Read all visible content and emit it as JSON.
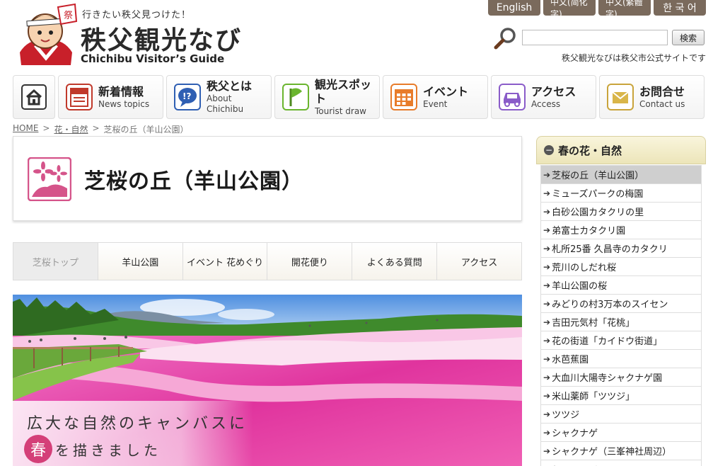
{
  "header": {
    "tagline": "行きたい秩父見つけた！",
    "site_name": "秩父観光なび",
    "site_sub": "Chichibu Visitor’s Guide",
    "mascot_label": "祭",
    "official_note": "秩父観光なびは秩父市公式サイトです"
  },
  "languages": [
    {
      "label": "English"
    },
    {
      "label": "中文(简化字)"
    },
    {
      "label": "中文(繁體字)"
    },
    {
      "label": "한 국 어"
    }
  ],
  "search": {
    "placeholder": "",
    "button_label": "検索",
    "icon": "magnifier-icon"
  },
  "nav": {
    "home_icon": "house-icon",
    "items": [
      {
        "ja": "新着情報",
        "en": "News topics",
        "icon": "news-icon",
        "color": "#c0392b"
      },
      {
        "ja": "秩父とは",
        "en": "About Chichibu",
        "icon": "question-bubble-icon",
        "color": "#2f5fb3"
      },
      {
        "ja": "観光スポット",
        "en": "Tourist draw",
        "icon": "flag-icon",
        "color": "#6ab52e"
      },
      {
        "ja": "イベント",
        "en": "Event",
        "icon": "calendar-icon",
        "color": "#e87c2a"
      },
      {
        "ja": "アクセス",
        "en": "Access",
        "icon": "car-icon",
        "color": "#8a5cc9"
      },
      {
        "ja": "お問合せ",
        "en": "Contact us",
        "icon": "envelope-icon",
        "color": "#c9a43b"
      }
    ]
  },
  "breadcrumb": {
    "home": "HOME",
    "sep": ">",
    "category": "花・自然",
    "current": "芝桜の丘（羊山公園）"
  },
  "page": {
    "title": "芝桜の丘（羊山公園）",
    "title_icon": "flower-icon",
    "accent_color": "#d5548a"
  },
  "sub_nav": [
    {
      "label": "芝桜トップ",
      "active": true
    },
    {
      "label": "羊山公園"
    },
    {
      "label": "イベント 花めぐり"
    },
    {
      "label": "開花便り"
    },
    {
      "label": "よくある質問"
    },
    {
      "label": "アクセス"
    }
  ],
  "hero": {
    "caption_line1": "広大な自然のキャンバスに",
    "caption_spring": "春",
    "caption_line2_rest": "を描きました"
  },
  "sidebar": {
    "title": "春の花・自然",
    "items": [
      {
        "label": "芝桜の丘（羊山公園）",
        "current": true
      },
      {
        "label": "ミューズパークの梅園"
      },
      {
        "label": "白砂公園カタクリの里"
      },
      {
        "label": "弟富士カタクリ園"
      },
      {
        "label": "札所25番 久昌寺のカタクリ"
      },
      {
        "label": "荒川のしだれ桜"
      },
      {
        "label": "羊山公園の桜"
      },
      {
        "label": "みどりの村3万本のスイセン"
      },
      {
        "label": "吉田元気村「花桃」"
      },
      {
        "label": "花の街道「カイドウ街道」"
      },
      {
        "label": "水芭蕉園"
      },
      {
        "label": "大血川大陽寺シャクナゲ園"
      },
      {
        "label": "米山薬師「ツツジ」"
      },
      {
        "label": "ツツジ"
      },
      {
        "label": "シャクナゲ"
      },
      {
        "label": "シャクナゲ（三峯神社周辺）"
      },
      {
        "label": "ヤマツツジ"
      }
    ]
  }
}
